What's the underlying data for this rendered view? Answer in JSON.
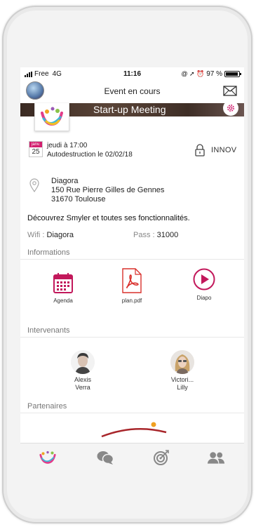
{
  "status_bar": {
    "carrier": "Free",
    "network": "4G",
    "time": "11:16",
    "battery": "97 %",
    "battery_level": 0.97
  },
  "header": {
    "title": "Event en cours",
    "icons": [
      "avatar",
      "mail-icon"
    ]
  },
  "event": {
    "name": "Start-up Meeting",
    "calendar_month": "janv.",
    "calendar_day": "25",
    "date_text": "jeudi à 17:00",
    "autodestruct_text": "Autodestruction le 02/02/18",
    "access_code": "INNOV",
    "place_name": "Diagora",
    "address_line1": "150 Rue Pierre Gilles de Gennes",
    "address_line2": "31670 Toulouse",
    "description": "Découvrez Smyler et toutes ses fonctionnalités.",
    "wifi_label": "Wifi : ",
    "wifi_value": "Diagora",
    "pass_label": "Pass : ",
    "pass_value": "31000"
  },
  "sections": {
    "informations": "Informations",
    "intervenants": "Intervenants",
    "partenaires": "Partenaires"
  },
  "info_tiles": [
    {
      "label": "Agenda",
      "icon": "calendar-icon"
    },
    {
      "label": "plan.pdf",
      "icon": "pdf-icon"
    },
    {
      "label": "Diapo",
      "icon": "play-icon"
    }
  ],
  "speakers": [
    {
      "first": "Alexis",
      "last": "Verra"
    },
    {
      "first": "Victori...",
      "last": "Lilly"
    }
  ],
  "tabbar": [
    "smyler-logo-icon",
    "chat-icon",
    "target-icon",
    "users-icon"
  ],
  "colors": {
    "accent": "#d21f6f",
    "pdf_red": "#d9302c"
  }
}
